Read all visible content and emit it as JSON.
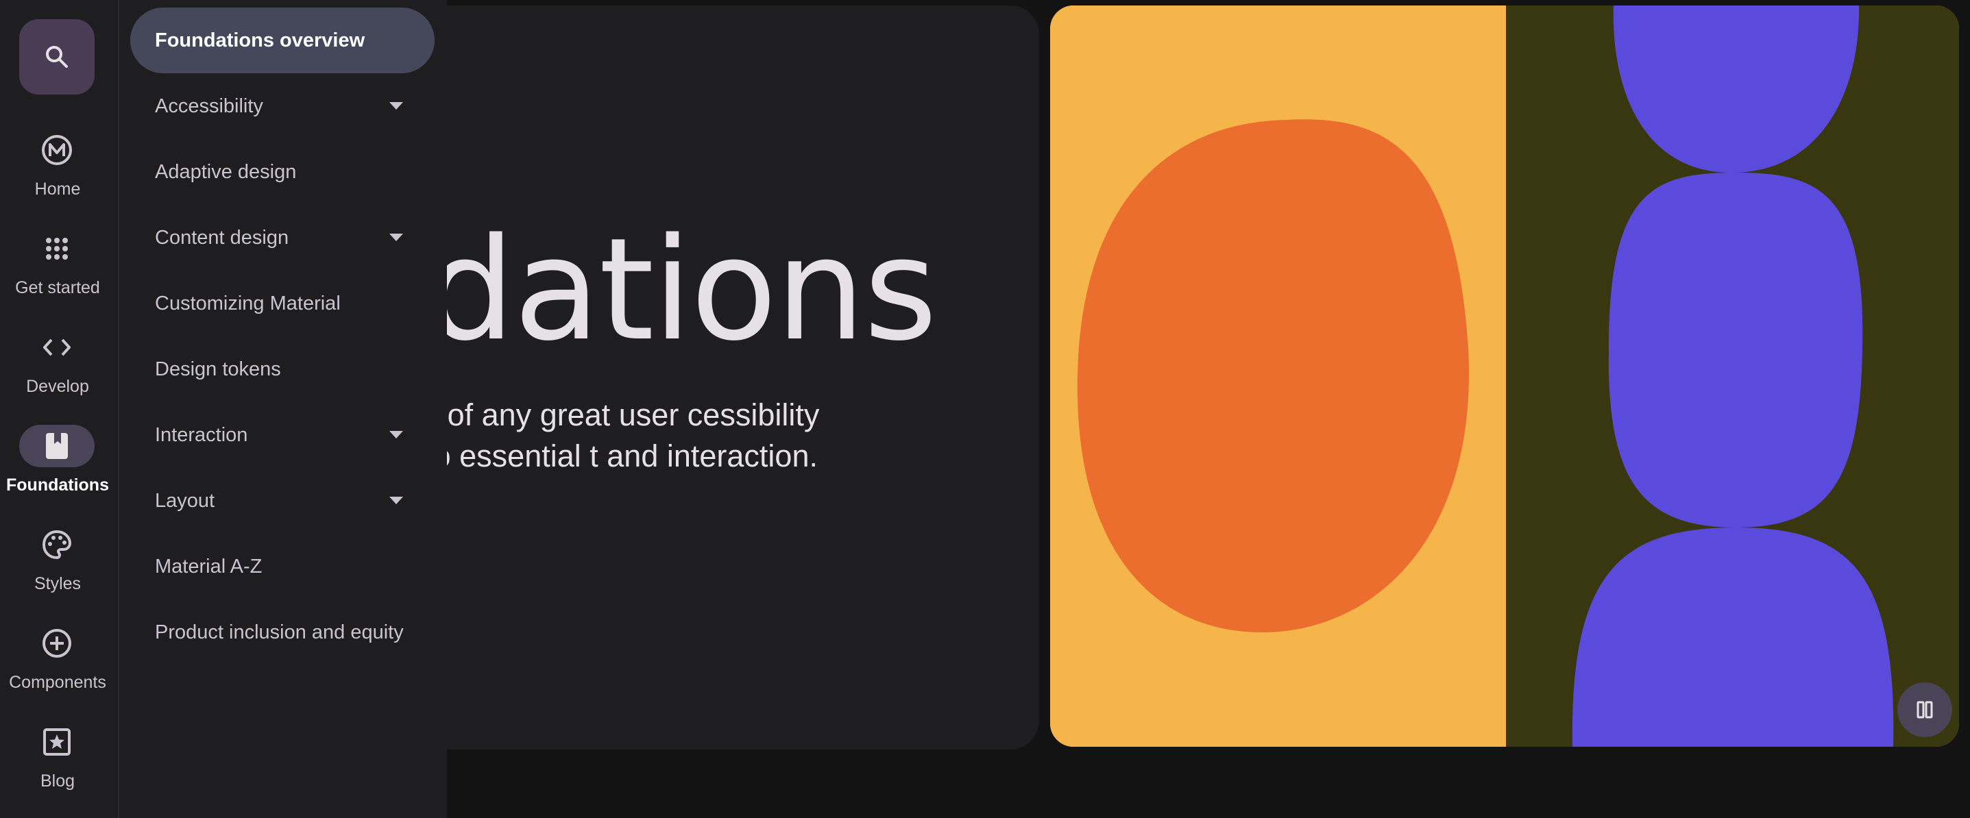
{
  "hero": {
    "title": "ndations",
    "description": "m the basis of any great user cessibility standards to essential t and interaction."
  },
  "rail": {
    "search_icon": "search-icon",
    "items": [
      {
        "label": "Home",
        "icon": "material-logo-icon"
      },
      {
        "label": "Get started",
        "icon": "apps-grid-icon"
      },
      {
        "label": "Develop",
        "icon": "code-icon"
      },
      {
        "label": "Foundations",
        "icon": "bookmark-book-icon",
        "active": true
      },
      {
        "label": "Styles",
        "icon": "palette-icon"
      },
      {
        "label": "Components",
        "icon": "add-circle-icon"
      },
      {
        "label": "Blog",
        "icon": "star-box-icon"
      }
    ]
  },
  "drawer": {
    "items": [
      {
        "label": "Foundations overview",
        "active": true,
        "expandable": false
      },
      {
        "label": "Accessibility",
        "expandable": true
      },
      {
        "label": "Adaptive design",
        "expandable": false
      },
      {
        "label": "Content design",
        "expandable": true
      },
      {
        "label": "Customizing Material",
        "expandable": false
      },
      {
        "label": "Design tokens",
        "expandable": false
      },
      {
        "label": "Interaction",
        "expandable": true
      },
      {
        "label": "Layout",
        "expandable": true
      },
      {
        "label": "Material A-Z",
        "expandable": false
      },
      {
        "label": "Product inclusion and equity",
        "expandable": false
      }
    ]
  },
  "art": {
    "pause_icon": "pause-icon",
    "colors": {
      "yellow": "#f5b54a",
      "olive": "#39370f",
      "orange": "#eb6e2e",
      "purple": "#5b4bdc"
    }
  },
  "colors": {
    "background": "#131314",
    "surface": "#1e1e20",
    "active_pill": "#45475a",
    "search_bg": "#4a3c55"
  }
}
